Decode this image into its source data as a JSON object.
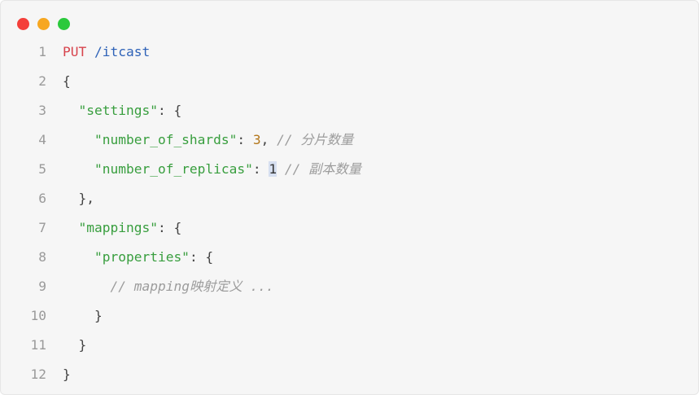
{
  "window": {
    "buttons": [
      "close",
      "minimize",
      "maximize"
    ],
    "colors": {
      "close": "#f43f3a",
      "minimize": "#f7a720",
      "maximize": "#2bc93c"
    }
  },
  "code": {
    "lines": [
      {
        "num": "1",
        "indent": "",
        "tokens": [
          {
            "t": "kw",
            "v": "PUT"
          },
          {
            "t": "txt",
            "v": " "
          },
          {
            "t": "path",
            "v": "/itcast"
          }
        ]
      },
      {
        "num": "2",
        "indent": "",
        "tokens": [
          {
            "t": "punct",
            "v": "{"
          }
        ]
      },
      {
        "num": "3",
        "indent": "  ",
        "tokens": [
          {
            "t": "str",
            "v": "\"settings\""
          },
          {
            "t": "punct",
            "v": ": {"
          }
        ]
      },
      {
        "num": "4",
        "indent": "    ",
        "tokens": [
          {
            "t": "str",
            "v": "\"number_of_shards\""
          },
          {
            "t": "punct",
            "v": ": "
          },
          {
            "t": "num",
            "v": "3"
          },
          {
            "t": "punct",
            "v": ", "
          },
          {
            "t": "cmt",
            "v": "// 分片数量"
          }
        ]
      },
      {
        "num": "5",
        "indent": "    ",
        "tokens": [
          {
            "t": "str",
            "v": "\"number_of_replicas\""
          },
          {
            "t": "punct",
            "v": ": "
          },
          {
            "t": "cursor",
            "v": "1"
          },
          {
            "t": "punct",
            "v": " "
          },
          {
            "t": "cmt",
            "v": "// 副本数量"
          }
        ]
      },
      {
        "num": "6",
        "indent": "  ",
        "tokens": [
          {
            "t": "punct",
            "v": "},"
          }
        ]
      },
      {
        "num": "7",
        "indent": "  ",
        "tokens": [
          {
            "t": "str",
            "v": "\"mappings\""
          },
          {
            "t": "punct",
            "v": ": {"
          }
        ]
      },
      {
        "num": "8",
        "indent": "    ",
        "tokens": [
          {
            "t": "str",
            "v": "\"properties\""
          },
          {
            "t": "punct",
            "v": ": {"
          }
        ]
      },
      {
        "num": "9",
        "indent": "      ",
        "tokens": [
          {
            "t": "cmt",
            "v": "// mapping映射定义 ..."
          }
        ]
      },
      {
        "num": "10",
        "indent": "    ",
        "tokens": [
          {
            "t": "punct",
            "v": "}"
          }
        ]
      },
      {
        "num": "11",
        "indent": "  ",
        "tokens": [
          {
            "t": "punct",
            "v": "}"
          }
        ]
      },
      {
        "num": "12",
        "indent": "",
        "tokens": [
          {
            "t": "punct",
            "v": "}"
          }
        ]
      }
    ]
  },
  "syntax_colors": {
    "keyword": "#d7434c",
    "path": "#2f63b8",
    "string": "#389e3e",
    "number": "#b3761a",
    "comment": "#9c9c9c",
    "line_number": "#9a9a9a"
  }
}
